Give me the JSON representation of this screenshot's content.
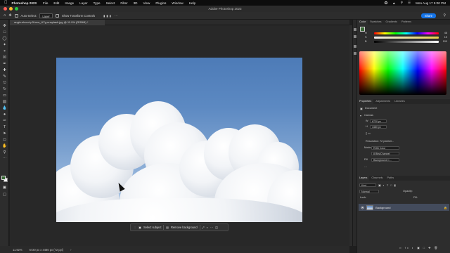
{
  "menubar": {
    "apple": "",
    "app": "Photoshop 2023",
    "menus": [
      "File",
      "Edit",
      "Image",
      "Layer",
      "Type",
      "Select",
      "Filter",
      "3D",
      "View",
      "Plugins",
      "Window",
      "Help"
    ],
    "datetime": "Mon Aug 17 5:00 PM"
  },
  "window": {
    "title": "Adobe Photoshop 2023"
  },
  "options_bar": {
    "auto_select_label": "Auto-Select:",
    "auto_select_value": "Layer",
    "transform_label": "Show Transform Controls",
    "share_label": "Share"
  },
  "document": {
    "tab_title": "angie-ekcurt-p3Lmw_H7g-unsplash.jpg @ 11.9% (RGB/8) *"
  },
  "contextual_taskbar": {
    "select_subject": "Select subject",
    "remove_background": "Remove background"
  },
  "status_bar": {
    "zoom": "11.92%",
    "doc_info": "6720 px x 4480 px (72 ppi)"
  },
  "color_panel": {
    "tabs": [
      "Color",
      "Swatches",
      "Gradients",
      "Patterns"
    ],
    "channels": [
      {
        "label": "H",
        "value": "48"
      },
      {
        "label": "S",
        "value": "15"
      },
      {
        "label": "B",
        "value": "100"
      }
    ]
  },
  "properties_panel": {
    "tabs": [
      "Properties",
      "Adjustments",
      "Libraries"
    ],
    "doc_label": "Document",
    "canvas_header": "Canvas",
    "width": "6720 px",
    "height": "4480 px",
    "resolution": "Resolution: 72 pixels/i...",
    "mode_label": "Mode",
    "mode_value": "RGB Color",
    "depth_value": "8 Bits/Channel",
    "fill_label": "Fill",
    "fill_value": "Background C..."
  },
  "layers_panel": {
    "tabs": [
      "Layers",
      "Channels",
      "Paths"
    ],
    "kind_placeholder": "Kind",
    "blend_mode": "Normal",
    "opacity_label": "Opacity:",
    "fill_label": "Fill:",
    "lock_label": "Lock:",
    "layer_name": "Background"
  },
  "colors": {
    "accent": "#1473e6",
    "foreground": "#3a6b36",
    "background": "#ffffff"
  }
}
